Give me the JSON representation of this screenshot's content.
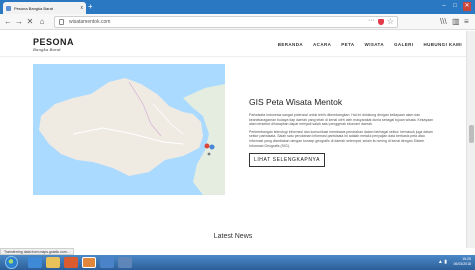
{
  "browser": {
    "tab_title": "Pesona Bangka Barat",
    "tab_close": "x",
    "new_tab": "+",
    "win_min": "–",
    "win_max": "□",
    "win_close": "✕",
    "url": "wisatamentok.com",
    "page_actions": "···",
    "back": "←",
    "forward": "→",
    "stop": "✕",
    "home": "⌂",
    "library": "\\\\\\",
    "sidebar": "▥",
    "menu": "≡"
  },
  "site": {
    "logo_main": "PESONA",
    "logo_sub": "Bangka Barat",
    "nav": [
      "BERANDA",
      "ACARA",
      "PETA",
      "WISATA",
      "GALERI",
      "HUBUNGI KAMI"
    ]
  },
  "main": {
    "title": "GIS Peta Wisata Mentok",
    "paragraphs": [
      "Pariwisata Indonesia sangat potensial untuk lebih dikembangkan. Hal ini didukung dengan kekayaan alam dan keanekaragaman budaya tiap daerah yang telah di kenal oleh oleh masyarakat dunia sebagai tujuan wisata. Kekayaan alam tersebut diharapkan dapat menjadi salah satu penggerak ekonomi daerah.",
      "Perkembangan teknologi informasi dan komunikasi membawa perubahan dalam berbagai sektor, termasuk juga dalam sektor pariwisata. Salah satu perubahan informasi pariwisata ini adalah melalui penyajian data berbasis peta atau informasi yang disediakan dengan konsep geografis di daerah setempat, selain itu sering di kenal dengan Sistem Informasi Geografis (SIG)."
    ],
    "button": "LIHAT SELENGKAPNYA",
    "latest": "Latest News"
  },
  "status": "Transferring data from maps.gstatic.com...",
  "taskbar": {
    "time": "15:25",
    "date": "06/03/2018"
  },
  "colors": {
    "titlebar": "#2b78c2",
    "map_water": "#aadaff",
    "map_land": "#efebe3",
    "taskbar": "#2c5f98"
  }
}
